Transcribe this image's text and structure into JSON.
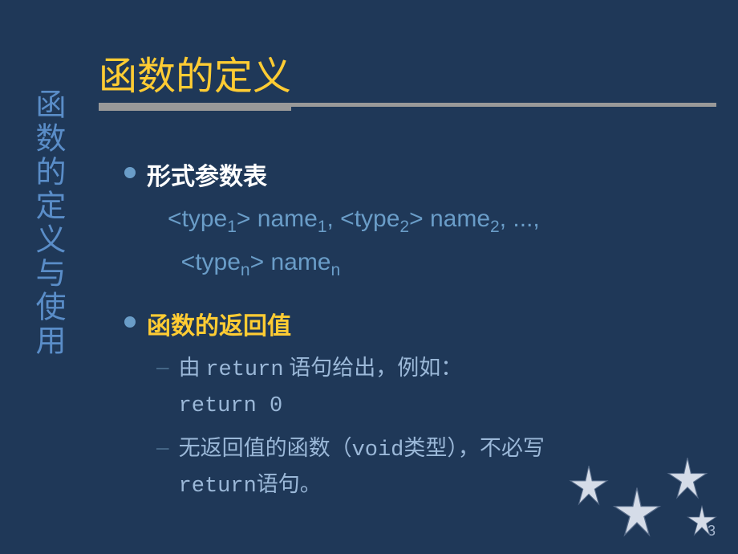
{
  "sidebar": {
    "title": "函数的定义与使用"
  },
  "header": {
    "title": "函数的定义"
  },
  "content": {
    "bullet1": {
      "title": "形式参数表",
      "syntax_parts": {
        "t1_open": "<type",
        "t1_sub": "1",
        "t1_close": "> name",
        "n1_sub": "1",
        "sep1": ", <type",
        "t2_sub": "2",
        "t2_close": "> name",
        "n2_sub": "2",
        "sep2": ", ..., ",
        "tn_open": "<type",
        "tn_sub": "n",
        "tn_close": "> name",
        "nn_sub": "n"
      }
    },
    "bullet2": {
      "title": "函数的返回值",
      "dash1": {
        "prefix": "由 ",
        "code1": "return",
        "mid": " 语句给出，例如：",
        "code2": "return  0"
      },
      "dash2": {
        "prefix": "无返回值的函数（",
        "code1": "void",
        "mid": "类型），不必写",
        "code2": "return",
        "suffix": "语句。"
      }
    }
  },
  "page": "3"
}
